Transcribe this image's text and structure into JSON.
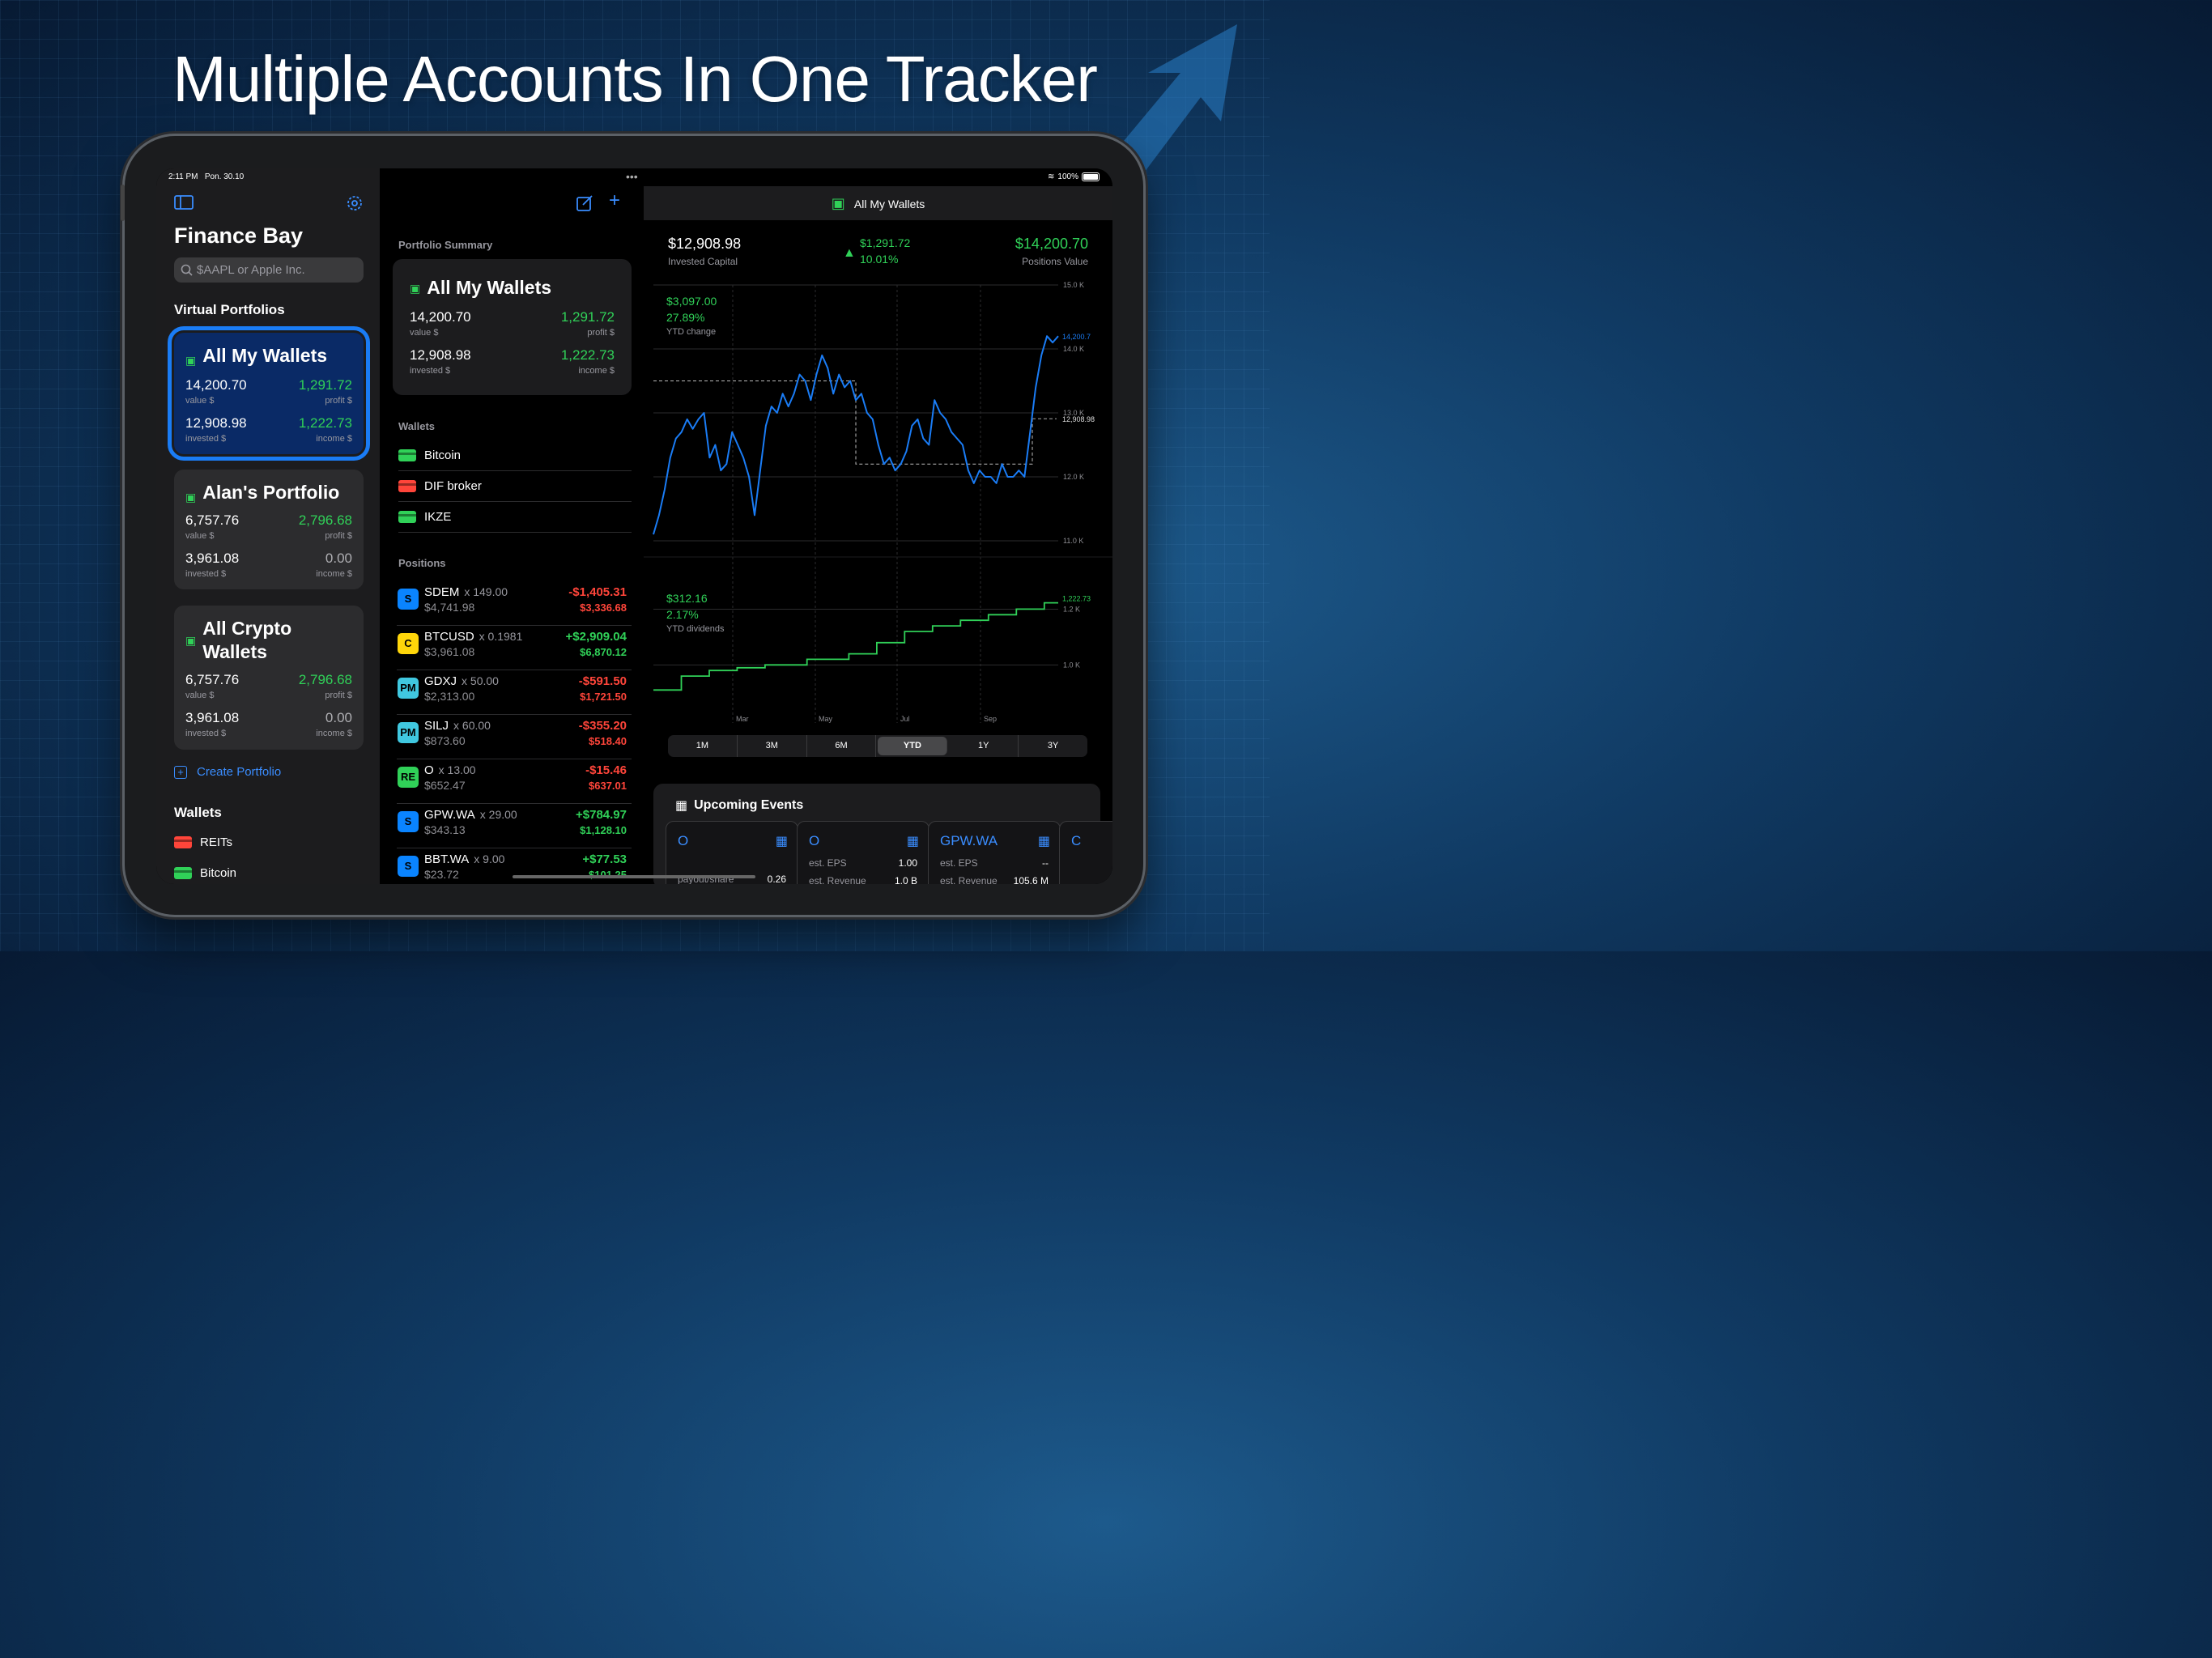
{
  "headline": "Multiple Accounts In One Tracker",
  "status": {
    "time": "2:11 PM",
    "date": "Pon. 30.10",
    "battery": "100%"
  },
  "colors": {
    "accent": "#0a84ff",
    "green": "#30d158",
    "red": "#ff453a",
    "bg": "#000000"
  },
  "sidebar": {
    "app_title": "Finance Bay",
    "search_placeholder": "$AAPL or Apple Inc.",
    "section_portfolios": "Virtual Portfolios",
    "portfolios": [
      {
        "name": "All My Wallets",
        "value": "14,200.70",
        "value_label": "value $",
        "profit": "1,291.72",
        "profit_label": "profit $",
        "invested": "12,908.98",
        "invested_label": "invested $",
        "income": "1,222.73",
        "income_label": "income $",
        "selected": true
      },
      {
        "name": "Alan's Portfolio",
        "value": "6,757.76",
        "value_label": "value $",
        "profit": "2,796.68",
        "profit_label": "profit $",
        "invested": "3,961.08",
        "invested_label": "invested $",
        "income": "0.00",
        "income_label": "income $"
      },
      {
        "name_line1": "All Crypto",
        "name_line2": "Wallets",
        "value": "6,757.76",
        "value_label": "value $",
        "profit": "2,796.68",
        "profit_label": "profit $",
        "invested": "3,961.08",
        "invested_label": "invested $",
        "income": "0.00",
        "income_label": "income $"
      }
    ],
    "create_portfolio": "Create Portfolio",
    "section_wallets": "Wallets",
    "wallets": [
      {
        "name": "REITs",
        "color": "#ff453a"
      },
      {
        "name": "Bitcoin",
        "color": "#30d158"
      }
    ]
  },
  "middle": {
    "summary_title": "Portfolio Summary",
    "summary": {
      "name": "All My Wallets",
      "value": "14,200.70",
      "value_label": "value $",
      "profit": "1,291.72",
      "profit_label": "profit $",
      "invested": "12,908.98",
      "invested_label": "invested $",
      "income": "1,222.73",
      "income_label": "income $"
    },
    "wallets_title": "Wallets",
    "wallets": [
      {
        "name": "Bitcoin",
        "color": "#30d158"
      },
      {
        "name": "DIF broker",
        "color": "#ff453a"
      },
      {
        "name": "IKZE",
        "color": "#30d158"
      }
    ],
    "positions_title": "Positions",
    "positions": [
      {
        "badge": "S",
        "badge_color": "#0a84ff",
        "symbol": "SDEM",
        "qty": "x 149.00",
        "amount": "$4,741.98",
        "change": "-$1,405.31",
        "change2": "$3,336.68",
        "positive": false
      },
      {
        "badge": "C",
        "badge_color": "#ffd60a",
        "symbol": "BTCUSD",
        "qty": "x 0.1981",
        "amount": "$3,961.08",
        "change": "+$2,909.04",
        "change2": "$6,870.12",
        "positive": true
      },
      {
        "badge": "PM",
        "badge_color": "#40c8e0",
        "symbol": "GDXJ",
        "qty": "x 50.00",
        "amount": "$2,313.00",
        "change": "-$591.50",
        "change2": "$1,721.50",
        "positive": false
      },
      {
        "badge": "PM",
        "badge_color": "#40c8e0",
        "symbol": "SILJ",
        "qty": "x 60.00",
        "amount": "$873.60",
        "change": "-$355.20",
        "change2": "$518.40",
        "positive": false
      },
      {
        "badge": "RE",
        "badge_color": "#30d158",
        "symbol": "O",
        "qty": "x 13.00",
        "amount": "$652.47",
        "change": "-$15.46",
        "change2": "$637.01",
        "positive": false
      },
      {
        "badge": "S",
        "badge_color": "#0a84ff",
        "symbol": "GPW.WA",
        "qty": "x 29.00",
        "amount": "$343.13",
        "change": "+$784.97",
        "change2": "$1,128.10",
        "positive": true
      },
      {
        "badge": "S",
        "badge_color": "#0a84ff",
        "symbol": "BBT.WA",
        "qty": "x 9.00",
        "amount": "$23.72",
        "change": "+$77.53",
        "change2": "$101.25",
        "positive": true
      }
    ]
  },
  "detail": {
    "title": "All My Wallets",
    "invested_capital": "$12,908.98",
    "invested_capital_label": "Invested Capital",
    "profit": "$1,291.72",
    "profit_pct": "10.01%",
    "positions_value": "$14,200.70",
    "positions_value_label": "Positions Value",
    "ytd_change": "$3,097.00",
    "ytd_change_pct": "27.89%",
    "ytd_change_label": "YTD change",
    "ytd_div": "$312.16",
    "ytd_div_pct": "2.17%",
    "ytd_div_label": "YTD dividends",
    "periods": [
      "1M",
      "3M",
      "6M",
      "YTD",
      "1Y",
      "3Y"
    ],
    "active_period": "YTD",
    "events_title": "Upcoming Events",
    "events": [
      {
        "symbol": "O",
        "row1_label": "",
        "row1_value": "",
        "row2_label": "payout/share",
        "row2_value": "0.26"
      },
      {
        "symbol": "O",
        "row1_label": "est. EPS",
        "row1_value": "1.00",
        "row2_label": "est. Revenue",
        "row2_value": "1.0 B"
      },
      {
        "symbol": "GPW.WA",
        "row1_label": "est. EPS",
        "row1_value": "--",
        "row2_label": "est. Revenue",
        "row2_value": "105.6 M"
      },
      {
        "symbol": "C",
        "row1_label": "",
        "row1_value": "",
        "row2_label": "",
        "row2_value": ""
      }
    ]
  },
  "chart_data": [
    {
      "type": "line",
      "title": "",
      "x_tick_labels": [
        "Mar",
        "May",
        "Jul",
        "Sep"
      ],
      "y_tick_labels": [
        "15.0 K",
        "14.0 K",
        "13.0 K",
        "12.0 K",
        "11.0 K"
      ],
      "ylim": [
        11000,
        15000
      ],
      "series": [
        {
          "values": [
            11100,
            11400,
            11800,
            12300,
            12600,
            12700,
            12900,
            12750,
            12900,
            13000,
            12300,
            12500,
            12100,
            12200,
            12700,
            12500,
            12300,
            12000,
            11400,
            12100,
            12800,
            13100,
            13000,
            13300,
            13100,
            13300,
            13600,
            13500,
            13200,
            13600,
            13900,
            13700,
            13300,
            13600,
            13400,
            13500,
            13200,
            13300,
            13000,
            12900,
            12500,
            12200,
            12300,
            12100,
            12200,
            12400,
            12800,
            12900,
            12600,
            12500,
            13200,
            13000,
            12900,
            12700,
            12600,
            12500,
            12100,
            11900,
            12100,
            12000,
            12000,
            11900,
            12200,
            12000,
            12000,
            12100,
            12000,
            12700,
            13400,
            13900,
            14200,
            14100,
            14200
          ]
        }
      ],
      "reference_lines": [
        {
          "label": "12,908.98",
          "value": 12908.98
        }
      ],
      "end_label": "14,200.7"
    },
    {
      "type": "line",
      "title": "",
      "y_tick_labels": [
        "1.2 K",
        "1.0 K"
      ],
      "ylim": [
        850,
        1300
      ],
      "series": [
        {
          "values": [
            910,
            910,
            960,
            960,
            980,
            980,
            990,
            990,
            1000,
            1000,
            1000,
            1020,
            1020,
            1020,
            1040,
            1040,
            1080,
            1080,
            1120,
            1120,
            1140,
            1140,
            1160,
            1160,
            1180,
            1180,
            1200,
            1200,
            1222.73,
            1222.73
          ]
        }
      ],
      "end_label": "1,222.73"
    }
  ]
}
